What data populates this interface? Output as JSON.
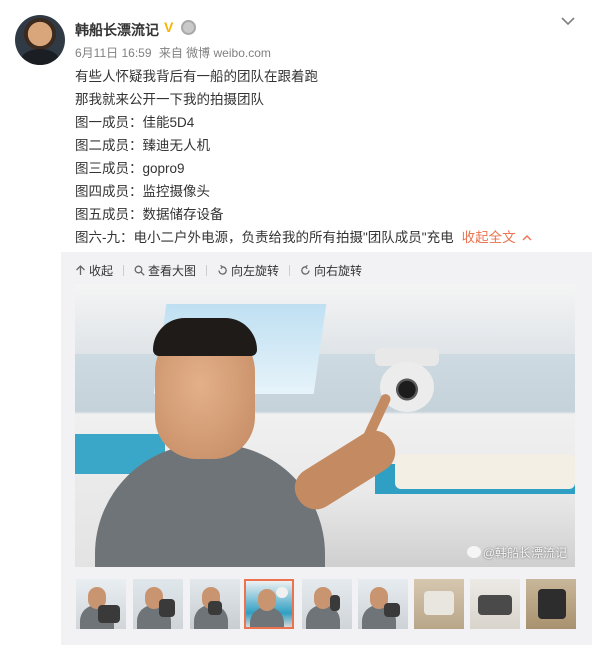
{
  "post": {
    "author": "韩船长漂流记",
    "verified_icon": "verified-v-icon",
    "medal_icon": "medal-icon",
    "date": "6月11日 16:59",
    "source": "来自 微博 weibo.com",
    "lines": [
      "有些人怀疑我背后有一船的团队在跟着跑",
      "那我就来公开一下我的拍摄团队",
      "图一成员：佳能5D4",
      "图二成员：臻迪无人机",
      "图三成员：gopro9",
      "图四成员：监控摄像头",
      "图五成员：数据储存设备",
      "图六-九：电小二户外电源，负责给我的所有拍摄\"团队成员\"充电"
    ],
    "collapse_label": "收起全文"
  },
  "toolbar": {
    "collapse": "收起",
    "view_large": "查看大图",
    "rotate_left": "向左旋转",
    "rotate_right": "向右旋转"
  },
  "photo": {
    "watermark": "@韩船长漂流记",
    "description": "man pointing at surveillance camera on boat"
  },
  "thumbnails": {
    "count": 9,
    "selected_index": 3
  },
  "colors": {
    "accent": "#eb7350",
    "verified": "#f7b500",
    "meta_gray": "#808080",
    "panel_bg": "#f2f2f5"
  }
}
